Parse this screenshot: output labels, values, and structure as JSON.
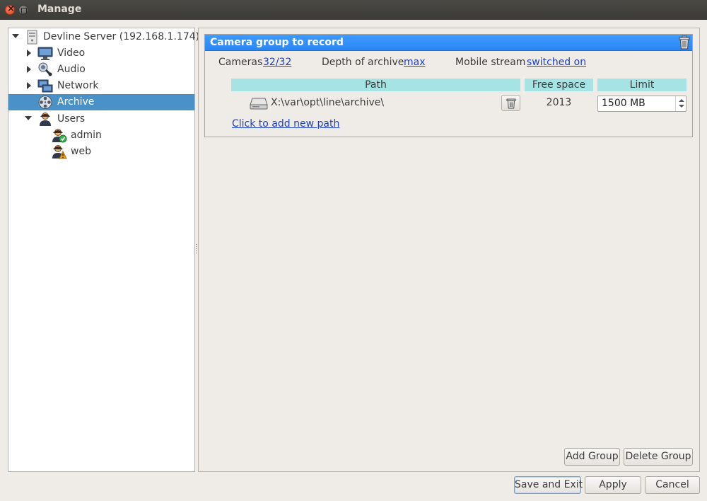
{
  "window": {
    "title": "Manage"
  },
  "tree": {
    "root": "Devline Server (192.168.1.174)",
    "items": [
      {
        "label": "Video"
      },
      {
        "label": "Audio"
      },
      {
        "label": "Network"
      },
      {
        "label": "Archive",
        "selected": true
      },
      {
        "label": "Users"
      },
      {
        "label": "admin"
      },
      {
        "label": "web"
      }
    ]
  },
  "group": {
    "title": "Camera group to record",
    "cameras_label": "Cameras",
    "cameras_value": "32/32",
    "depth_label": "Depth of archive",
    "depth_value": "max",
    "mobile_label": "Mobile stream",
    "mobile_value": "switched on",
    "columns": {
      "path": "Path",
      "free": "Free space",
      "limit": "Limit"
    },
    "rows": [
      {
        "path": "X:\\var\\opt\\line\\archive\\",
        "free": "2013",
        "limit": "1500 MB"
      }
    ],
    "add_path": "Click to add new path"
  },
  "buttons": {
    "add_group": "Add Group",
    "delete_group": "Delete Group",
    "save_exit": "Save and Exit",
    "apply": "Apply",
    "cancel": "Cancel"
  },
  "colors": {
    "selection": "#4a91c7",
    "group_header": "#2b86f3",
    "column_header": "#a6e3e4",
    "link": "#1f3fc4"
  }
}
